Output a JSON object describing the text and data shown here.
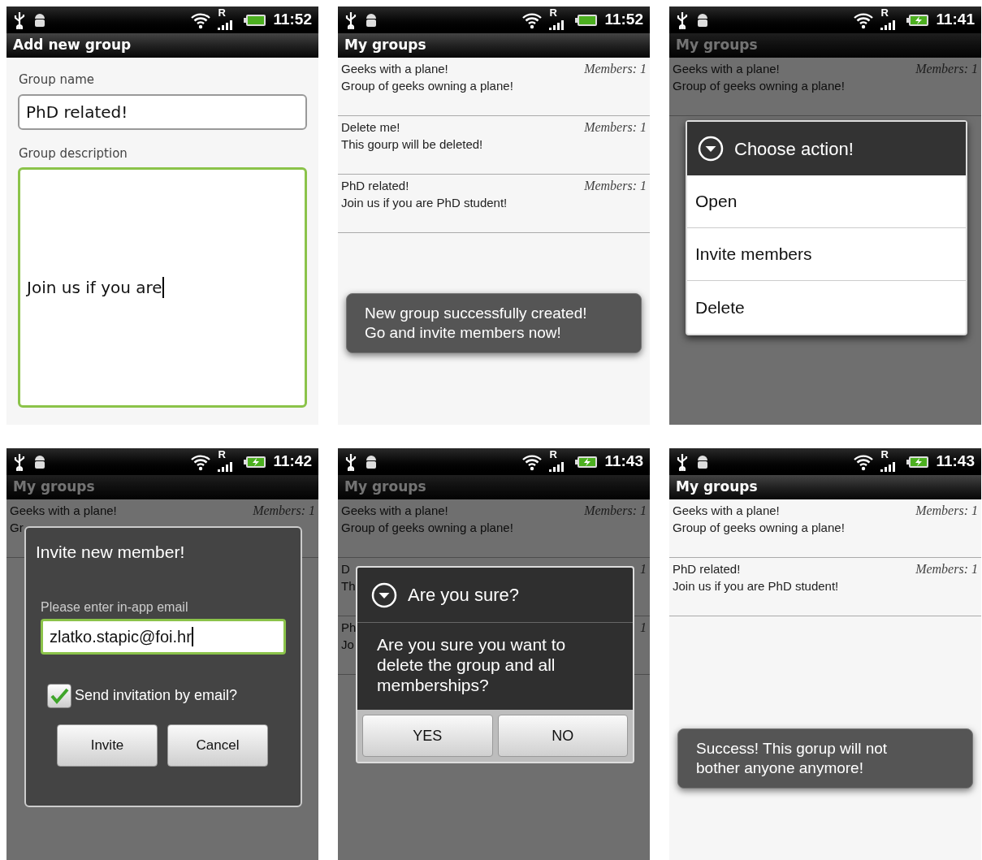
{
  "screens": [
    {
      "kind": "form",
      "status": {
        "network": "R",
        "charging": false,
        "time": "11:52"
      },
      "title": "Add new group",
      "dimmed": false,
      "fields": [
        {
          "label": "Group name",
          "value": "PhD related!",
          "focused": false,
          "multiline": false
        },
        {
          "label": "Group description",
          "value": "Join us if you are",
          "focused": true,
          "multiline": true
        }
      ]
    },
    {
      "kind": "list",
      "status": {
        "network": "R",
        "charging": false,
        "time": "11:52"
      },
      "title": "My groups",
      "dimmed": false,
      "groups": [
        {
          "name": "Geeks with a plane!",
          "members": "Members: 1",
          "description": "Group of geeks owning a plane!"
        },
        {
          "name": "Delete me!",
          "members": "Members: 1",
          "description": "This gourp will be deleted!"
        },
        {
          "name": "PhD related!",
          "members": "Members: 1",
          "description": "Join us if you are PhD student!"
        }
      ],
      "toast": {
        "lines": [
          "New group successfully created!",
          "Go and invite members now!"
        ]
      }
    },
    {
      "kind": "list",
      "status": {
        "network": "R",
        "charging": true,
        "time": "11:41"
      },
      "title": "My groups",
      "dimmed": true,
      "groups": [
        {
          "name": "Geeks with a plane!",
          "members": "Members: 1",
          "description": "Group of geeks owning a plane!"
        }
      ],
      "dialog": {
        "kind": "menu",
        "title": "Choose action!",
        "items": [
          "Open",
          "Invite members",
          "Delete"
        ]
      }
    },
    {
      "kind": "list",
      "status": {
        "network": "R",
        "charging": true,
        "time": "11:42"
      },
      "title": "My groups",
      "dimmed": true,
      "groups": [
        {
          "name": "Geeks with a plane!",
          "members": "Members: 1",
          "description": "Gr"
        }
      ],
      "dialog": {
        "kind": "invite",
        "title": "Invite new member!",
        "label": "Please enter in-app email",
        "value": "zlatko.stapic@foi.hr",
        "focused": true,
        "checkbox": {
          "label": "Send invitation by email?",
          "checked": true
        },
        "buttons": [
          "Invite",
          "Cancel"
        ]
      }
    },
    {
      "kind": "list",
      "status": {
        "network": "R",
        "charging": true,
        "time": "11:43"
      },
      "title": "My groups",
      "dimmed": true,
      "groups": [
        {
          "name": "Geeks with a plane!",
          "members": "Members: 1",
          "description": "Group of geeks owning a plane!"
        },
        {
          "name": "D",
          "members": "1",
          "description": "Th"
        },
        {
          "name": "Ph",
          "members": "1",
          "description": "Jo"
        }
      ],
      "dialog": {
        "kind": "confirm",
        "title": "Are you sure?",
        "message": "Are you sure you want to delete the group and all memberships?",
        "buttons": [
          "YES",
          "NO"
        ]
      }
    },
    {
      "kind": "list",
      "status": {
        "network": "R",
        "charging": true,
        "time": "11:43"
      },
      "title": "My groups",
      "dimmed": false,
      "groups": [
        {
          "name": "Geeks with a plane!",
          "members": "Members: 1",
          "description": "Group of geeks owning a plane!"
        },
        {
          "name": "PhD related!",
          "members": "Members: 1",
          "description": "Join us if you are PhD student!"
        }
      ],
      "toast": {
        "lines": [
          "Success! This gorup will not",
          "bother anyone anymore!"
        ]
      }
    }
  ]
}
